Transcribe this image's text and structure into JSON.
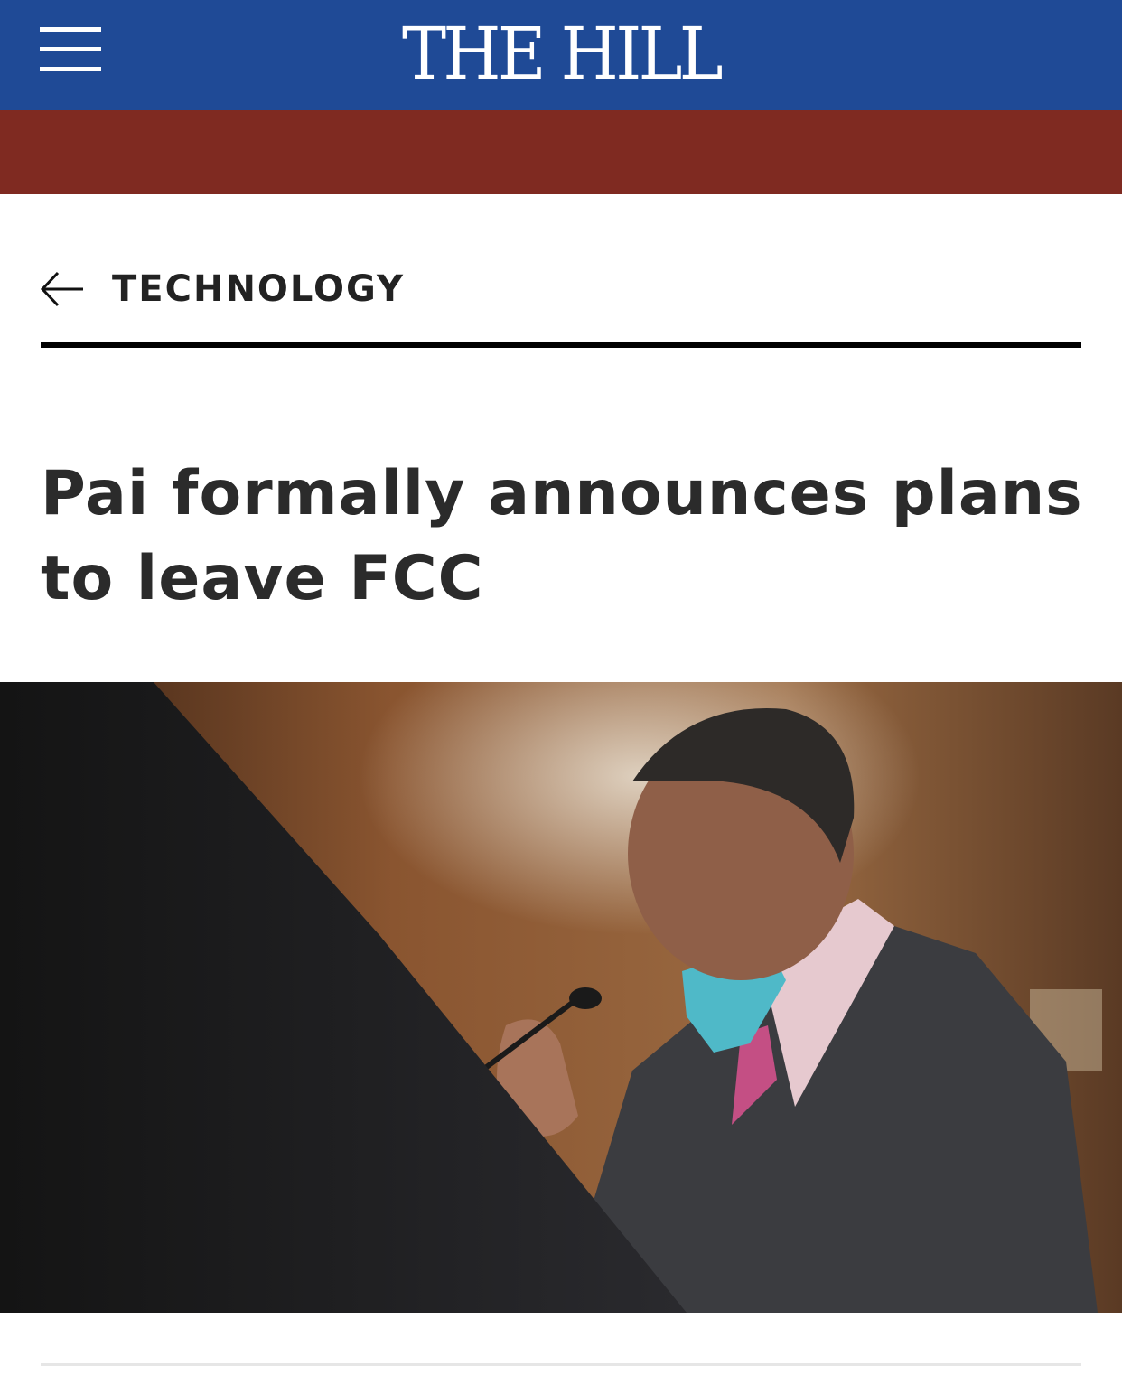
{
  "header": {
    "logo_text": "THE HILL",
    "menu_icon": "hamburger-menu-icon",
    "colors": {
      "blue_bar": "#1f4a96",
      "red_bar": "#7f2a21"
    }
  },
  "section": {
    "back_icon": "arrow-left-icon",
    "label": "TECHNOLOGY"
  },
  "article": {
    "headline": "Pai formally announces plans to leave FCC"
  }
}
